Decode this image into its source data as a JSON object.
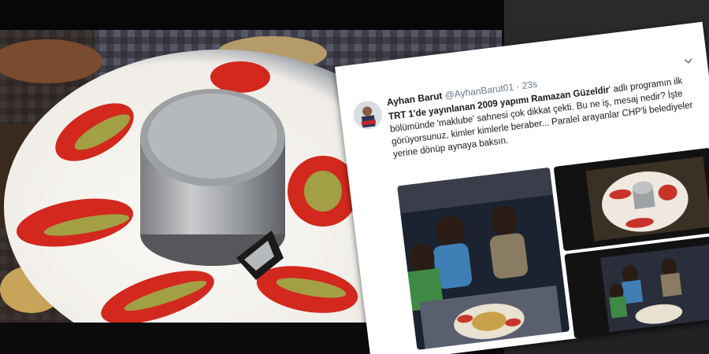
{
  "tweet": {
    "display_name": "Ayhan Barut",
    "handle": "@AyhanBarut01",
    "separator": "·",
    "time": "23s",
    "text_1": "",
    "text_2": "TRT 1'de yayınlanan 2009 yapımı ",
    "text_3": "Ramazan Güzeldir",
    "text_4": "' adlı programın ilk bölümünde 'maklube' sahnesi çok dikkat çekti. Bu ne iş, mesaj nedir? İşte görüyorsunuz, kimler kimlerle beraber... Paralel arayanlar CHP'li belediyeler yerine dönüp aynaya baksın."
  },
  "icons": {
    "menu": "chevron-down-icon"
  },
  "colors": {
    "text": "#14171a",
    "secondary": "#657786",
    "background_dark": "#222224"
  }
}
